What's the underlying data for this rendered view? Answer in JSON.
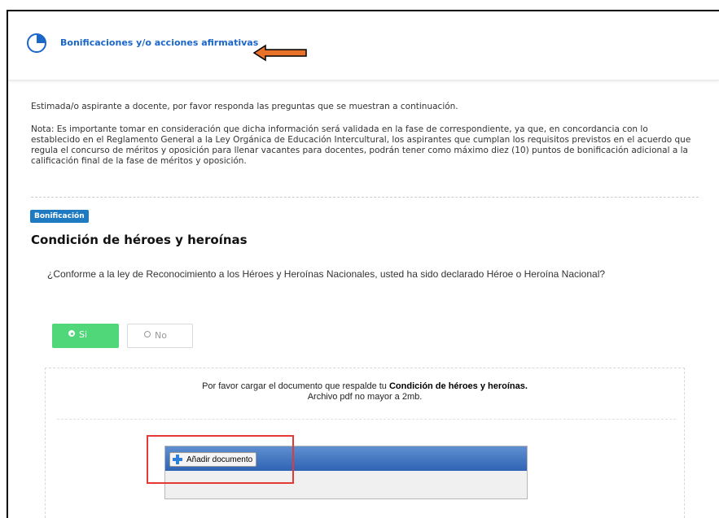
{
  "header": {
    "title": "Bonificaciones y/o acciones afirmativas",
    "icon": "pie-chart-icon",
    "arrow_color": "#e8722a"
  },
  "intro": "Estimada/o aspirante a docente, por favor responda las preguntas que se muestran a continuación.",
  "note": "Nota: Es importante tomar en consideración que dicha información será validada en la fase de correspondiente, ya que, en concordancia con lo establecido en el Reglamento General a la Ley Orgánica de Educación Intercultural, los aspirantes que cumplan los requisitos previstos en el acuerdo que regula el concurso de méritos y oposición para llenar vacantes para docentes, podrán tener como máximo diez (10) puntos de bonificación adicional a la calificación final de la fase de méritos y oposición.",
  "badge": "Bonificación",
  "section_title": "Condición de héroes y heroínas",
  "question": "¿Conforme a la ley de Reconocimiento a los Héroes y Heroínas Nacionales, usted ha sido declarado Héroe o Heroína Nacional?",
  "options": {
    "yes": "Si",
    "no": "No",
    "selected": "Si"
  },
  "upload": {
    "line1_prefix": "Por favor cargar el documento que respalde tu ",
    "line1_bold": "Condición de héroes y heroínas.",
    "line2": "Archivo pdf no mayor a 2mb.",
    "add_button": "Añadir documento"
  },
  "colors": {
    "accent": "#1b66c9",
    "badge": "#1e7bc2",
    "selected_option": "#4fd779",
    "highlight_box": "#e53935"
  }
}
